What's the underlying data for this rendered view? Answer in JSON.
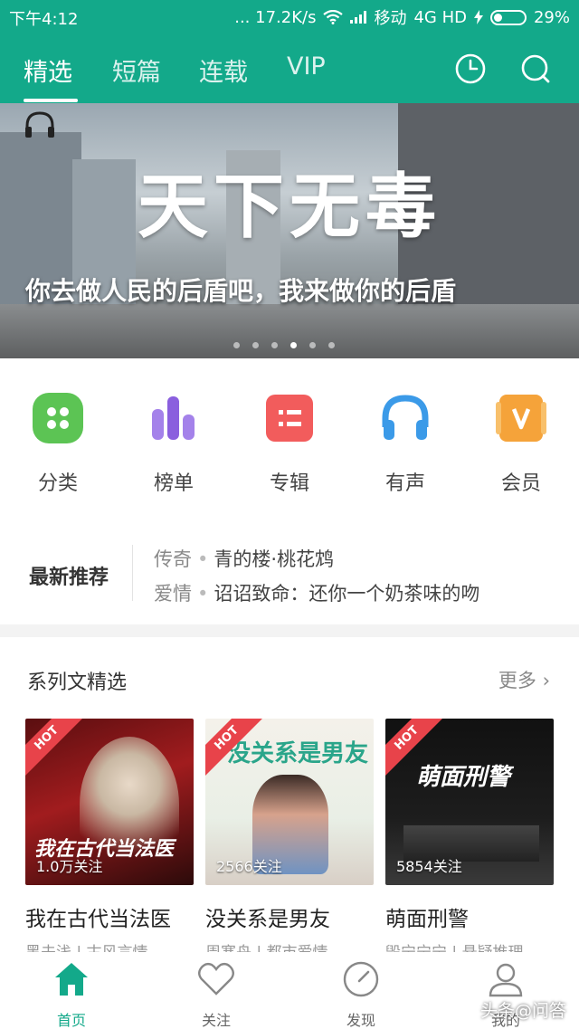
{
  "status_bar": {
    "time": "下午4:12",
    "network_speed": "... 17.2K/s",
    "carrier": "移动",
    "network": "4G HD",
    "battery": "29%",
    "battery_level": 0.29
  },
  "header": {
    "tabs": [
      {
        "label": "精选",
        "active": true
      },
      {
        "label": "短篇",
        "active": false
      },
      {
        "label": "连载",
        "active": false
      },
      {
        "label": "VIP",
        "active": false
      }
    ],
    "icons": [
      "clock-icon",
      "search-icon"
    ]
  },
  "banner": {
    "title": "天下无毒",
    "subtitle": "你去做人民的后盾吧，我来做你的后盾",
    "slide_count": 6,
    "active_slide": 4
  },
  "categories": [
    {
      "label": "分类",
      "icon": "category-icon",
      "color": "#5cc454"
    },
    {
      "label": "榜单",
      "icon": "chart-icon",
      "color": "#9b6ee0"
    },
    {
      "label": "专辑",
      "icon": "album-icon",
      "color": "#f25c5c"
    },
    {
      "label": "有声",
      "icon": "headphones-icon",
      "color": "#3b9ae8"
    },
    {
      "label": "会员",
      "icon": "vip-icon",
      "color": "#f5a33a"
    }
  ],
  "latest": {
    "label": "最新推荐",
    "items": [
      {
        "tag": "传奇",
        "text": "青的楼·桃花鸩"
      },
      {
        "tag": "爱情",
        "text": "诏诏致命：还你一个奶茶味的吻"
      }
    ]
  },
  "series": {
    "title": "系列文精选",
    "more": "更多",
    "books": [
      {
        "hot": "HOT",
        "cover_title": "我在古代当法医",
        "follows": "1.0万关注",
        "name": "我在古代当法医",
        "meta": "黑夫浅 | 古风言情"
      },
      {
        "hot": "HOT",
        "cover_title": "没关系是男友",
        "follows": "2566关注",
        "name": "没关系是男友",
        "meta": "周寒舟 | 都市爱情"
      },
      {
        "hot": "HOT",
        "cover_title": "萌面刑警",
        "follows": "5854关注",
        "name": "萌面刑警",
        "meta": "毁宁宁宁 | 悬疑推理"
      }
    ]
  },
  "bottom_nav": [
    {
      "label": "首页",
      "icon": "home-icon",
      "active": true
    },
    {
      "label": "关注",
      "icon": "heart-icon",
      "active": false
    },
    {
      "label": "发现",
      "icon": "compass-icon",
      "active": false
    },
    {
      "label": "我的",
      "icon": "user-icon",
      "active": false
    }
  ],
  "watermark": "头条@问答",
  "colors": {
    "brand": "#13a98a",
    "hot": "#e8434a"
  }
}
